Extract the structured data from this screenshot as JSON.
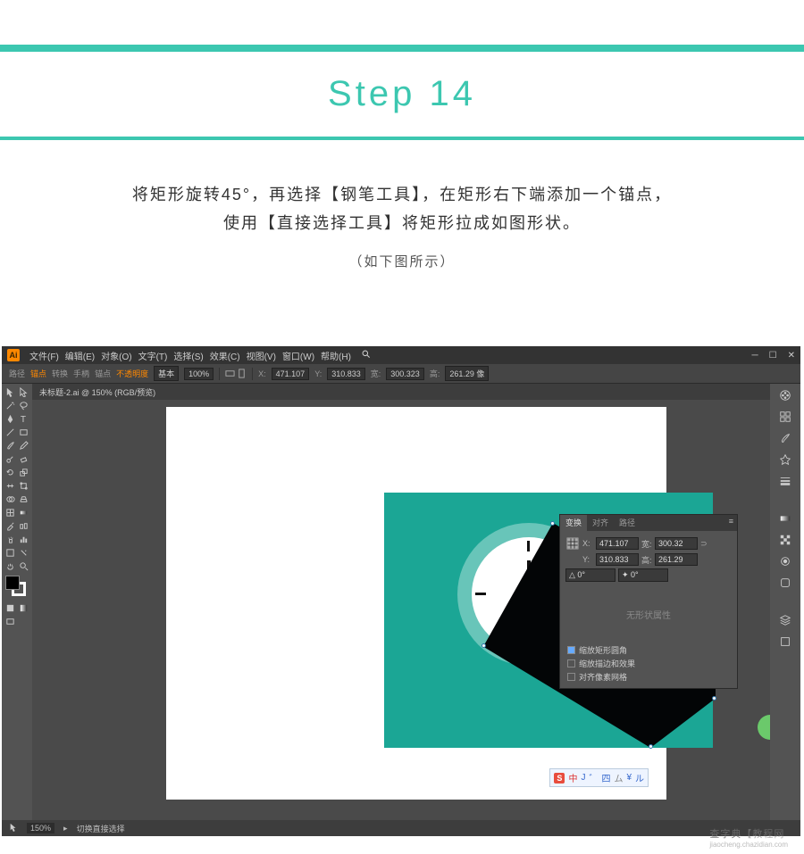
{
  "header": {
    "step_label": "Step 14",
    "instruction_line1": "将矩形旋转45°，再选择【钢笔工具】，在矩形右下端添加一个锚点，",
    "instruction_line2": "使用【直接选择工具】将矩形拉成如图形状。",
    "subnote": "（如下图所示）"
  },
  "menubar": {
    "items": [
      "文件(F)",
      "编辑(E)",
      "对象(O)",
      "文字(T)",
      "选择(S)",
      "效果(C)",
      "视图(V)",
      "窗口(W)",
      "帮助(H)"
    ],
    "search_icon": "search"
  },
  "optionbar": {
    "path_label": "路径",
    "anchor_label": "锚点",
    "convert_label": "转换",
    "handle_label": "手柄",
    "anchors_label": "锚点",
    "nopass_label": "不透明度",
    "style_label": "基本",
    "opacity": "100%",
    "transform": {
      "x_label": "X:",
      "x_val": "471.107",
      "y_label": "Y:",
      "310_label": "",
      "y_val": "310.833",
      "w_label": "宽:",
      "w_val": "300.323",
      "h_label": "高:",
      "h_val": "261.29 像"
    }
  },
  "tab": {
    "name": "未标题-2.ai @ 150% (RGB/预览)"
  },
  "panel": {
    "tabs": [
      "变换",
      "对齐",
      "路径"
    ],
    "x_label": "X:",
    "x_val": "471.107",
    "w_label": "宽:",
    "w_val": "300.32",
    "y_label": "Y:",
    "y_val": "310.833",
    "h_label": "高:",
    "h_val": "261.29",
    "angle1": "△ 0°",
    "angle2": "✦ 0°",
    "no_shape": "无形状属性",
    "opts": [
      "缩放矩形圆角",
      "缩放描边和效果",
      "对齐像素网格"
    ]
  },
  "statusbar": {
    "zoom": "150%",
    "tool": "切换直接选择"
  },
  "ime": {
    "chars": [
      "中",
      "J",
      "゛",
      "四",
      "ム",
      "¥",
      "ル"
    ]
  },
  "watermark": {
    "main": "查字典",
    "bracket": "【教程网",
    "url": "jiaocheng.chazidian.com"
  },
  "colors": {
    "accent": "#3cc7b0",
    "artwork_teal": "#1ba695",
    "ring": "#68c5b9",
    "shadow": "#030506"
  }
}
